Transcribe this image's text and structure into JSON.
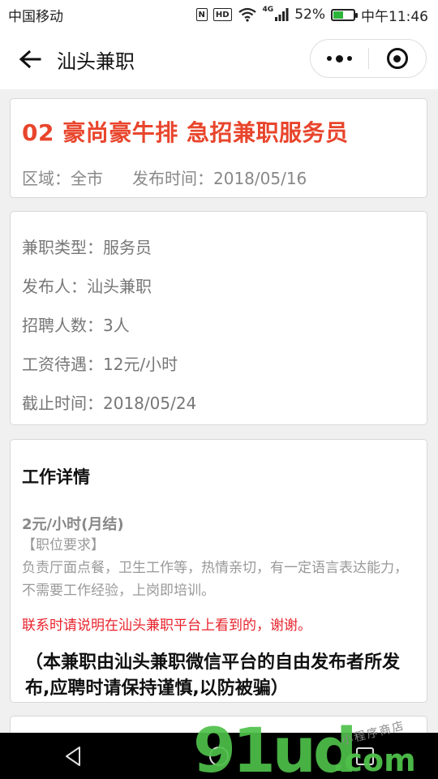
{
  "status_bar": {
    "carrier": "中国移动",
    "nfc": "N",
    "hd": "HD",
    "network": "4G",
    "battery_percent": "52%",
    "battery_level": 0.52,
    "time": "中午11:46"
  },
  "nav": {
    "title": "汕头兼职"
  },
  "job": {
    "title": "02 豪尚豪牛排 急招兼职服务员",
    "region": "区域：全市",
    "publish_time": "发布时间：2018/05/16"
  },
  "info": {
    "type": "兼职类型：服务员",
    "publisher": "发布人：汕头兼职",
    "headcount": "招聘人数：3人",
    "salary": "工资待遇：12元/小时",
    "deadline": "截止时间：2018/05/24"
  },
  "details": {
    "heading": "工作详情",
    "pay": "2元/小时(月结)",
    "requirement_title": "【职位要求】",
    "requirement_text": "负责厅面点餐，卫生工作等，热情亲切，有一定语言表达能力，不需要工作经验，上岗即培训。",
    "notice": "联系时请说明在汕头兼职平台上看到的，谢谢。",
    "disclaimer": "（本兼职由汕头兼职微信平台的自由发布者所发布,应聘时请保持谨慎,以防被骗）"
  },
  "watermark": {
    "logo": "91ud",
    "domain": ".com",
    "script": "小程序商店"
  },
  "colors": {
    "accent_red": "#e8452c",
    "notice_red": "#e8232c",
    "battery_green": "#2db43a",
    "watermark_green": "#4fc14a"
  },
  "icons": [
    "back-arrow-icon",
    "more-dots-icon",
    "close-target-icon",
    "back-triangle-icon",
    "home-circle-icon",
    "recents-square-icon",
    "wifi-icon",
    "signal-icon",
    "battery-icon"
  ]
}
